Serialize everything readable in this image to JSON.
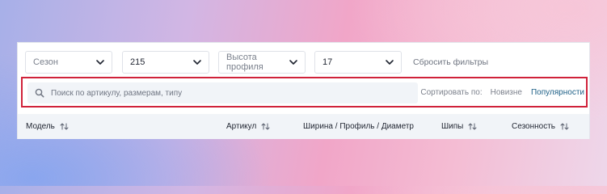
{
  "filters": {
    "season": {
      "value": "",
      "placeholder": "Сезон"
    },
    "width": {
      "value": "215",
      "placeholder": ""
    },
    "profile": {
      "value": "",
      "placeholder": "Высота профиля"
    },
    "diameter": {
      "value": "17",
      "placeholder": ""
    },
    "reset_label": "Сбросить фильтры"
  },
  "search": {
    "placeholder": "Поиск по артикулу, размерам, типу"
  },
  "sort": {
    "label": "Сортировать по:",
    "options": [
      {
        "label": "Новизне",
        "active": false
      },
      {
        "label": "Популярности",
        "active": true
      }
    ]
  },
  "table": {
    "columns": [
      {
        "label": "Модель",
        "sortable": true
      },
      {
        "label": "Артикул",
        "sortable": true
      },
      {
        "label": "Ширина / Профиль / Диаметр",
        "sortable": false
      },
      {
        "label": "Шипы",
        "sortable": true
      },
      {
        "label": "Сезонность",
        "sortable": true
      }
    ]
  },
  "icons": {
    "chevron": "chevron-down-icon",
    "search": "search-icon",
    "sort": "sort-arrows-icon"
  },
  "colors": {
    "accent": "#1d5f86",
    "highlight_border": "#d0223a",
    "muted_bg": "#f1f4f8"
  }
}
